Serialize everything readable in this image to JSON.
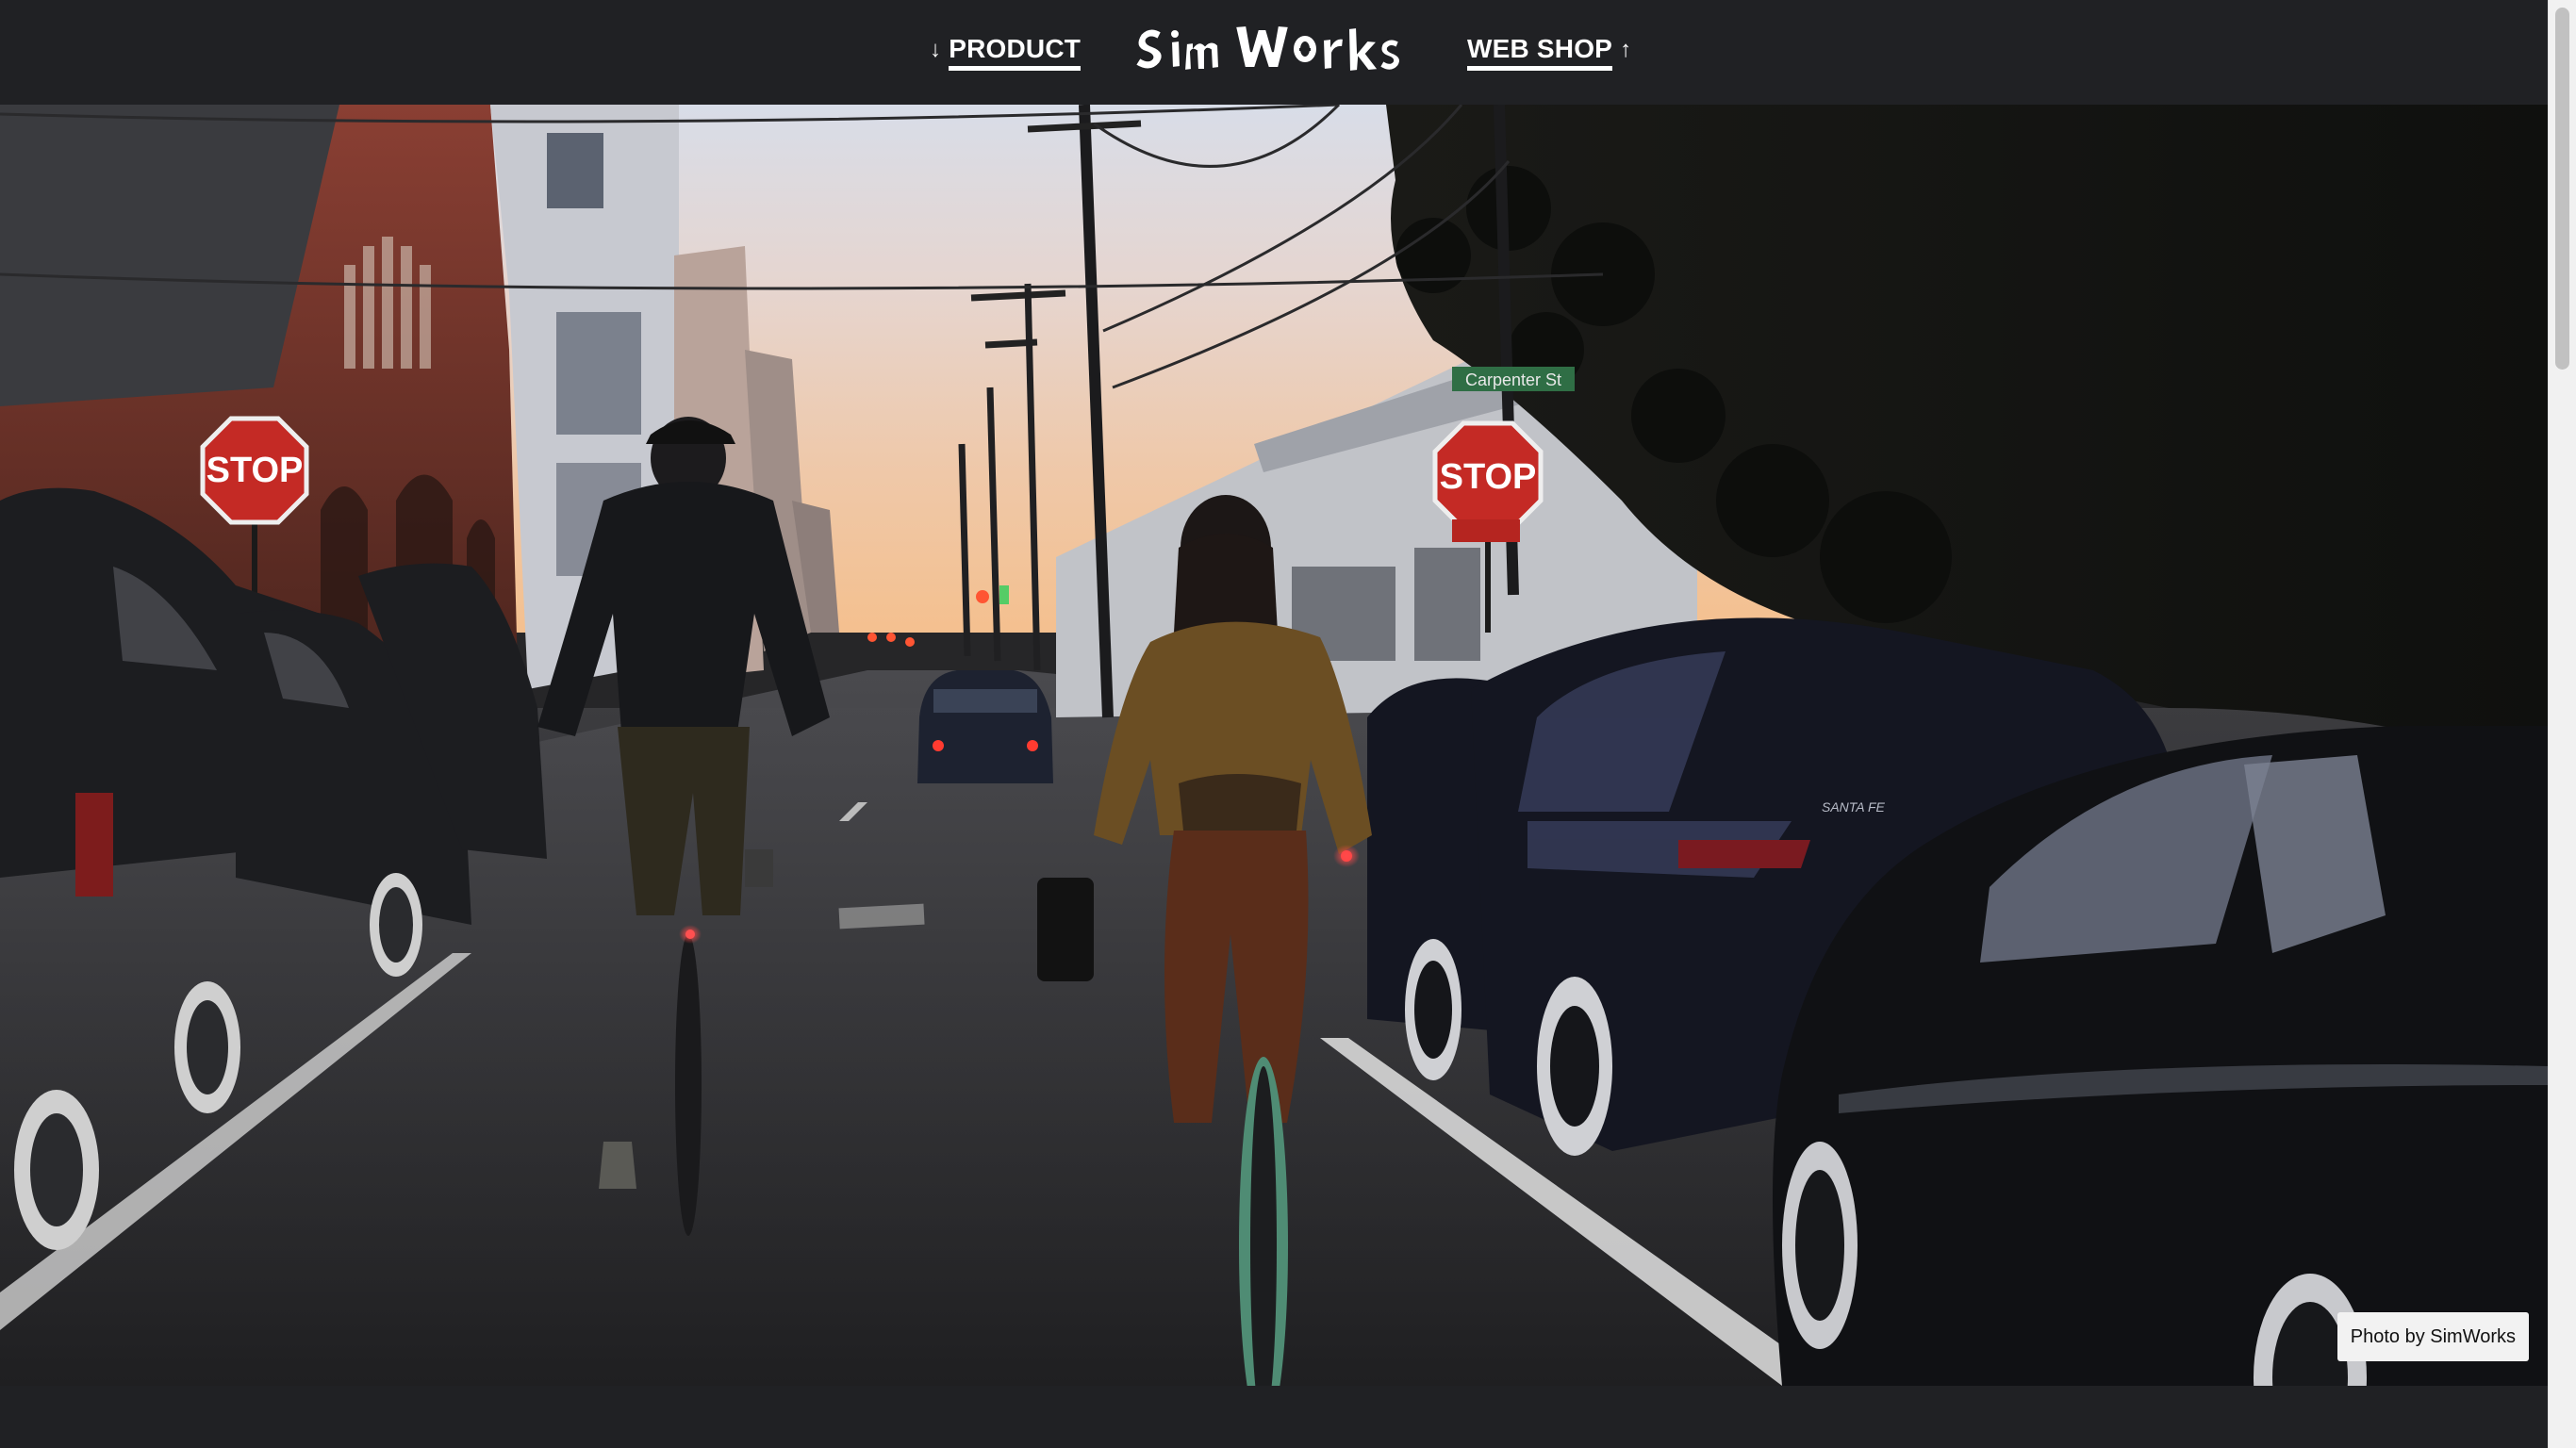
{
  "header": {
    "product_label": "PRODUCT",
    "product_arrow": "↓",
    "webshop_label": "WEB SHOP",
    "webshop_arrow": "↑",
    "logo_text": "Sim Works"
  },
  "hero": {
    "photo_credit": "Photo by SimWorks",
    "stop_sign_text": "STOP",
    "street_sign_text": "Carpenter St",
    "store_sign_text": "SANTA FE"
  },
  "colors": {
    "header_bg": "#202124",
    "link_color": "#ffffff",
    "credit_bg": "#f2f2f2"
  }
}
